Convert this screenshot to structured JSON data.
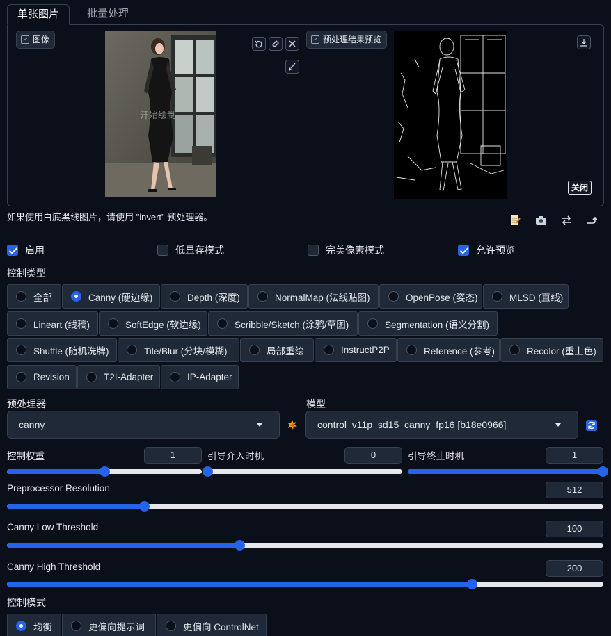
{
  "tabs": [
    "单张图片",
    "批量处理"
  ],
  "input_image": {
    "label": "图像",
    "overlay_text": "开始绘制"
  },
  "preview": {
    "label": "预处理结果预览",
    "close_label": "关闭"
  },
  "hint": "如果使用白底黑线图片，请使用 \"invert\" 预处理器。",
  "checkboxes": [
    {
      "label": "启用",
      "checked": true
    },
    {
      "label": "低显存模式",
      "checked": false
    },
    {
      "label": "完美像素模式",
      "checked": false
    },
    {
      "label": "允许预览",
      "checked": true
    }
  ],
  "control_type": {
    "label": "控制类型",
    "selected": "Canny (硬边缘)",
    "options": [
      "全部",
      "Canny (硬边缘)",
      "Depth (深度)",
      "NormalMap (法线贴图)",
      "OpenPose (姿态)",
      "MLSD (直线)",
      "Lineart (线稿)",
      "SoftEdge (软边缘)",
      "Scribble/Sketch (涂鸦/草图)",
      "Segmentation (语义分割)",
      "Shuffle (随机洗牌)",
      "Tile/Blur (分块/模糊)",
      "局部重绘",
      "InstructP2P",
      "Reference (参考)",
      "Recolor (重上色)",
      "Revision",
      "T2I-Adapter",
      "IP-Adapter"
    ]
  },
  "preprocessor": {
    "label": "预处理器",
    "value": "canny"
  },
  "model": {
    "label": "模型",
    "value": "control_v11p_sd15_canny_fp16 [b18e0966]"
  },
  "sliders": {
    "weight": {
      "label": "控制权重",
      "value": "1",
      "fraction": 0.5
    },
    "start": {
      "label": "引导介入时机",
      "value": "0",
      "fraction": 0.0
    },
    "end": {
      "label": "引导终止时机",
      "value": "1",
      "fraction": 1.0
    },
    "resolution": {
      "label": "Preprocessor Resolution",
      "value": "512",
      "fraction": 0.23
    },
    "low": {
      "label": "Canny Low Threshold",
      "value": "100",
      "fraction": 0.39
    },
    "high": {
      "label": "Canny High Threshold",
      "value": "200",
      "fraction": 0.78
    }
  },
  "control_mode": {
    "label": "控制模式",
    "selected": "均衡",
    "options": [
      "均衡",
      "更偏向提示词",
      "更偏向 ControlNet"
    ]
  },
  "colors": {
    "accent": "#2563eb",
    "background": "#0b0f19",
    "surface": "#1f2937",
    "border": "#374151"
  },
  "icons": [
    "image-icon",
    "undo-icon",
    "eraser-icon",
    "close-icon",
    "brush-icon",
    "download-icon",
    "explosion-icon",
    "refresh-icon",
    "notepad-icon",
    "camera-icon",
    "swap-icon",
    "send-icon"
  ]
}
